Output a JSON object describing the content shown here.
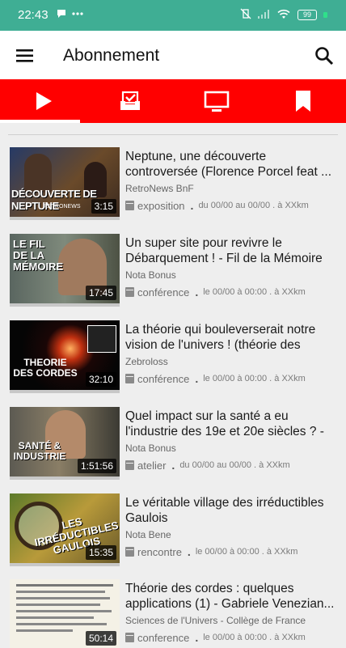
{
  "status_bar": {
    "time": "22:43",
    "battery": "99"
  },
  "app_bar": {
    "title": "Abonnement"
  },
  "tabs": [
    {
      "name": "videos-tab",
      "icon": "play-icon",
      "active": true
    },
    {
      "name": "tasks-tab",
      "icon": "checkbox-tray-icon",
      "active": false
    },
    {
      "name": "tv-tab",
      "icon": "tv-icon",
      "active": false
    },
    {
      "name": "saved-tab",
      "icon": "bookmark-icon",
      "active": false
    }
  ],
  "colors": {
    "status_bar": "#3fae94",
    "tab_bar": "#ff0000",
    "background": "#eeeeee"
  },
  "videos": [
    {
      "title": "Neptune, une découverte controversée (Florence Porcel feat ...",
      "channel": "RetroNews BnF",
      "type": "exposition",
      "dates": "du 00/00 au 00/00 . à XXkm",
      "duration": "3:15",
      "thumb_text": "DÉCOUVERTE DE NEPTUNE",
      "thumb_sub": "RETRONEWS"
    },
    {
      "title": "Un super site pour revivre le Débarquement ! - Fil de la Mémoire",
      "channel": "Nota Bonus",
      "type": "conférence",
      "dates": "le 00/00 à 00:00 . à XXkm",
      "duration": "17:45",
      "thumb_text": "LE FIL DE LA MÉMOIRE",
      "thumb_sub": ""
    },
    {
      "title": "La théorie qui bouleverserait notre vision de l'univers ! (théorie des cord...",
      "channel": "Zebroloss",
      "type": "conférence",
      "dates": "le 00/00 à 00:00 . à XXkm",
      "duration": "32:10",
      "thumb_text": "THEORIE DES CORDES",
      "thumb_sub": ""
    },
    {
      "title": "Quel impact sur la santé a eu l'industrie des 19e et 20e siècles ? - ...",
      "channel": "Nota Bonus",
      "type": "atelier",
      "dates": "du 00/00 au 00/00 . à XXkm",
      "duration": "1:51:56",
      "thumb_text": "SANTÉ & INDUSTRIE",
      "thumb_sub": ""
    },
    {
      "title": "Le véritable village des irréductibles Gaulois",
      "channel": "Nota Bene",
      "type": "rencontre",
      "dates": "le 00/00 à 00:00 . à XXkm",
      "duration": "15:35",
      "thumb_text": "LES IRRÉDUCTIBLES GAULOIS",
      "thumb_sub": ""
    },
    {
      "title": "Théorie des cordes : quelques applications (1) - Gabriele Venezian...",
      "channel": "Sciences de l'Univers - Collège de France",
      "type": "conference",
      "dates": "le 00/00 à 00:00 . à XXkm",
      "duration": "50:14",
      "thumb_text": "",
      "thumb_sub": ""
    }
  ]
}
